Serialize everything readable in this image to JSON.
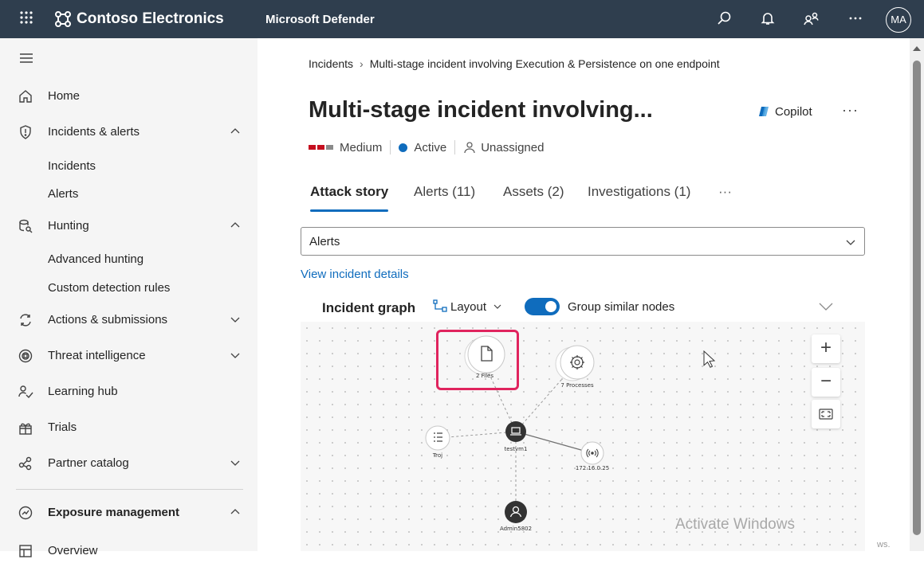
{
  "topbar": {
    "brand": "Contoso Electronics",
    "product": "Microsoft Defender",
    "avatar_initials": "MA",
    "icons": [
      "waffle-icon",
      "contoso-logo-icon",
      "search-icon",
      "bell-icon",
      "people-icon",
      "more-icon"
    ]
  },
  "sidebar": {
    "items": [
      {
        "label": "Home"
      },
      {
        "label": "Incidents & alerts"
      },
      {
        "label": "Incidents"
      },
      {
        "label": "Alerts"
      },
      {
        "label": "Hunting"
      },
      {
        "label": "Advanced hunting"
      },
      {
        "label": "Custom detection rules"
      },
      {
        "label": "Actions & submissions"
      },
      {
        "label": "Threat intelligence"
      },
      {
        "label": "Learning hub"
      },
      {
        "label": "Trials"
      },
      {
        "label": "Partner catalog"
      },
      {
        "label": "Exposure management"
      },
      {
        "label": "Overview"
      }
    ]
  },
  "breadcrumb": {
    "root": "Incidents",
    "current": "Multi-stage incident involving Execution & Persistence on one endpoint"
  },
  "incident": {
    "title": "Multi-stage incident involving...",
    "copilot": "Copilot",
    "severity": "Medium",
    "status": "Active",
    "assignee": "Unassigned"
  },
  "tabs": [
    {
      "label": "Attack story"
    },
    {
      "label": "Alerts (11)"
    },
    {
      "label": "Assets (2)"
    },
    {
      "label": "Investigations (1)"
    }
  ],
  "alerts_select": {
    "value": "Alerts"
  },
  "view_details_link": "View incident details",
  "graph": {
    "title": "Incident graph",
    "layout_label": "Layout",
    "group_similar_label": "Group similar nodes",
    "group_similar_on": true,
    "nodes": [
      {
        "label": "2 Files",
        "icon": "file-icon"
      },
      {
        "label": "7 Processes",
        "icon": "gear-icon"
      },
      {
        "label": "Troj",
        "icon": "list-icon"
      },
      {
        "label": "testvm1",
        "icon": "laptop-icon"
      },
      {
        "label": "172.16.0.25",
        "icon": "broadcast-icon"
      },
      {
        "label": "Admin5802",
        "icon": "user-icon"
      }
    ]
  },
  "watermark": {
    "line1": "Activate Windows",
    "fragment": "ws."
  },
  "colors": {
    "topbar": "#2f3e4e",
    "accent": "#0f6cbd",
    "severity_red": "#c50f1f",
    "highlight": "#e0245e"
  }
}
